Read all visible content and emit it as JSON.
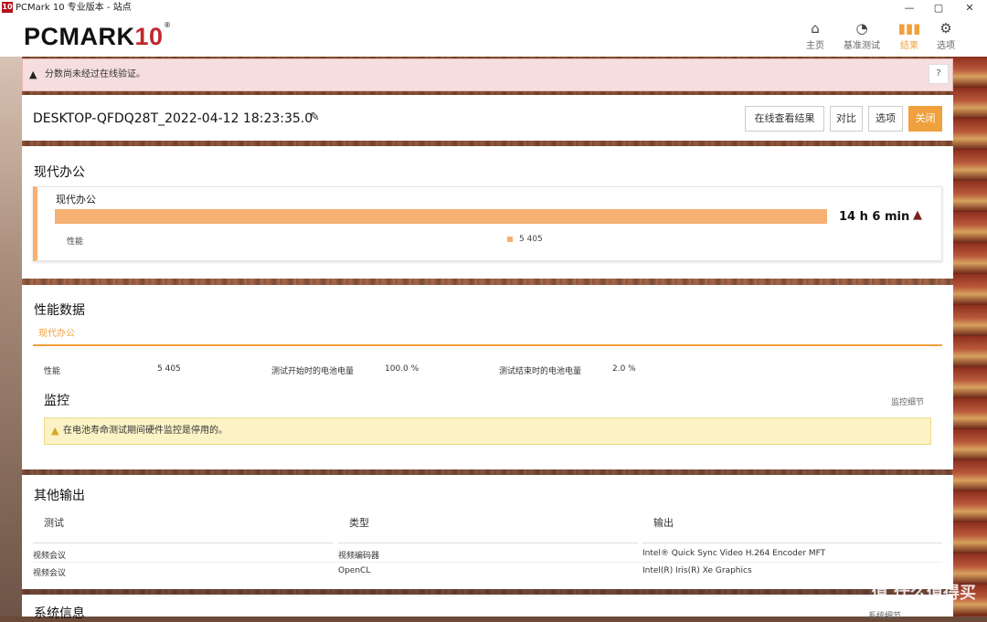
{
  "window": {
    "badge": "10",
    "title": "PCMark 10 专业版本 - 站点",
    "minimize": "—",
    "maximize": "▢",
    "close": "✕"
  },
  "header": {
    "logo_main": "PCMARK",
    "logo_num": "10",
    "logo_reg": "®",
    "nav": [
      {
        "label": "主页",
        "icon": "home-icon"
      },
      {
        "label": "基准测试",
        "icon": "gauge-icon"
      },
      {
        "label": "结果",
        "icon": "bar-chart-icon",
        "active": true
      },
      {
        "label": "选项",
        "icon": "gear-icon"
      }
    ]
  },
  "alert": {
    "text": "分数尚未经过在线验证。",
    "help": "?"
  },
  "result": {
    "title": "DESKTOP-QFDQ28T_2022-04-12 18:23:35.0",
    "buttons": {
      "view_online": "在线查看结果",
      "compare": "对比",
      "options": "选项",
      "close": "关闭"
    }
  },
  "summary": {
    "heading": "现代办公",
    "card_title": "现代办公",
    "bar_value": "14 h 6 min",
    "bar_fill": 1.0,
    "perf_label": "性能",
    "perf_value": "5 405"
  },
  "perf_data": {
    "heading": "性能数据",
    "tab": "现代办公",
    "row": {
      "perf_label": "性能",
      "perf_value": "5 405",
      "start_label": "测试开始时的电池电量",
      "start_value": "100.0 %",
      "end_label": "测试结束时的电池电量",
      "end_value": "2.0 %"
    },
    "monitor_heading": "监控",
    "monitor_link": "监控细节",
    "notice": "在电池寿命测试期间硬件监控是停用的。"
  },
  "other_output": {
    "heading": "其他输出",
    "columns": [
      "测试",
      "类型",
      "输出"
    ],
    "rows": [
      [
        "视频会议",
        "视频编码器",
        "Intel® Quick Sync Video H.264 Encoder MFT"
      ],
      [
        "视频会议",
        "OpenCL",
        "Intel(R) Iris(R) Xe Graphics"
      ]
    ]
  },
  "system_info": {
    "heading": "系统信息",
    "link": "系统细节"
  },
  "watermark": "值 什么值得买",
  "colors": {
    "accent": "#f0a03c",
    "bar": "#f6b072",
    "alert_bg": "#f6dede",
    "notice_bg": "#fbf3c6",
    "brand_red": "#c0282d"
  }
}
